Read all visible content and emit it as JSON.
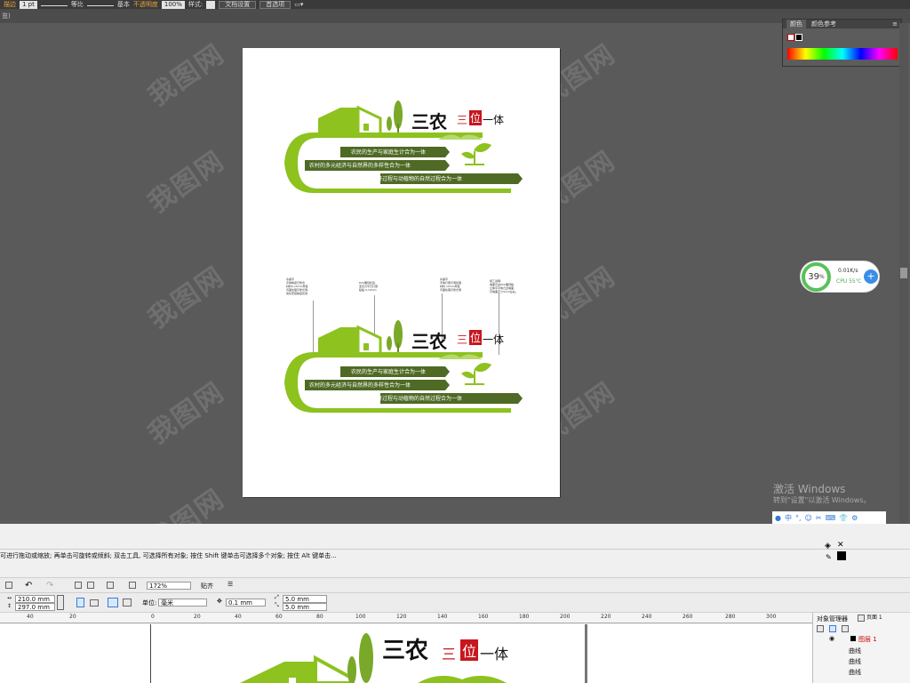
{
  "top_toolbar": {
    "menu_label": "描边",
    "stroke_weight": "1 pt",
    "profile1": "等比",
    "profile2": "基本",
    "opacity_label": "不透明度",
    "opacity_value": "100%",
    "style_label": "样式:",
    "doc_setup": "文档设置",
    "preferences": "首选项"
  },
  "tab_fragment": "览)",
  "color_panel": {
    "tab1": "颜色",
    "tab2": "颜色参考"
  },
  "watermark": "我图网",
  "design": {
    "title_a": "三农",
    "title_b1": "三",
    "title_b2": "位",
    "title_b3": "一体",
    "lines": [
      "农民的生产与家庭生计合为一体",
      "农村的多元经济与自然界的多样性合为一体",
      "农业的经济过程与动植物的自然过程合为一体"
    ]
  },
  "notes": [
    [
      "水晶字",
      "字体精度已整合",
      "材料5-10mm厚度",
      "背面处理平整光滑,",
      "简化安装精度实用"
    ],
    [
      "PVC雕刻标签,",
      "亚克力字已打磨",
      "粘贴 5-10mm"
    ],
    [
      "水晶字",
      "字体打磨平滑处理",
      "材料 10mm厚度",
      "背面处理平整光滑"
    ],
    [
      "施工说明:",
      "墙面可采PVC雕刻板,",
      "立体字字体凸出墙面,",
      "背墙面尺寸3mm左右。"
    ]
  ],
  "cpu": {
    "percent": "39",
    "percent_unit": "%",
    "speed": "0.01K/s",
    "temp": "CPU 55℃"
  },
  "activation": {
    "line1": "激活 Windows",
    "line2": "转到\"设置\"以激活 Windows。"
  },
  "ime_label": "中",
  "status_text": "可进行拖动或缩放; 再单击可旋转或倾斜; 双击工具, 可选择所有对象; 按住 Shift 键单击可选择多个对象; 按住 Alt 键单击...",
  "cd_toolbar": {
    "zoom": "172%",
    "snap": "贴齐",
    "width": "210.0 mm",
    "height": "297.0 mm",
    "units_label": "单位:",
    "units_value": "毫米",
    "nudge": "0.1 mm",
    "dup_x": "5.0 mm",
    "dup_y": "5.0 mm"
  },
  "ruler": [
    "40",
    "20",
    "0",
    "20",
    "40",
    "60",
    "80",
    "100",
    "120",
    "140",
    "160",
    "180",
    "200",
    "220",
    "240",
    "260",
    "280",
    "300"
  ],
  "object_manager": {
    "title": "对象管理器",
    "layer": "图层 1",
    "page": "页面 1",
    "items": [
      "曲线",
      "曲线",
      "曲线"
    ]
  },
  "colors": {
    "green": "#8dc21f",
    "dark_green": "#5a7a2a",
    "red": "#c8161d"
  }
}
